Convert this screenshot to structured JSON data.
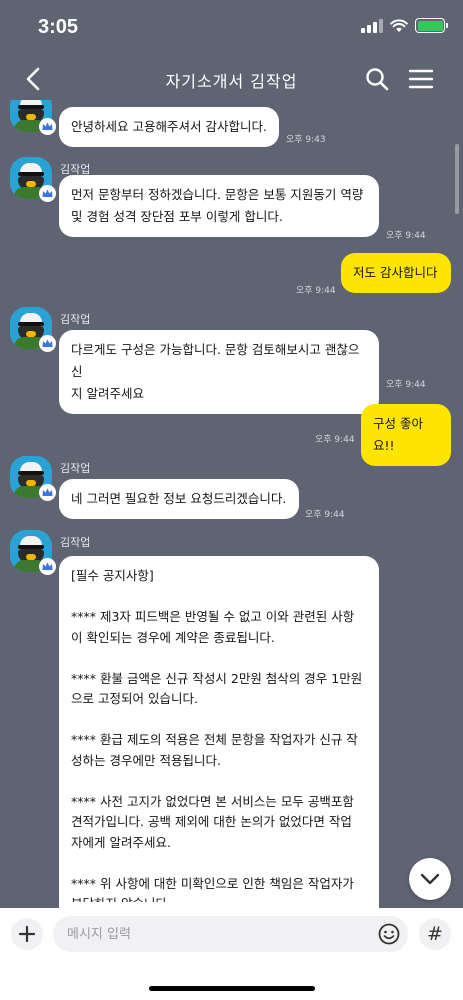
{
  "status": {
    "time": "3:05"
  },
  "header": {
    "title": "자기소개서 김작업"
  },
  "chat": {
    "messages": [
      {
        "sender": "",
        "text": "안녕하세요 고용해주셔서 감사합니다.",
        "time": "오후 9:43"
      },
      {
        "sender": "김작업",
        "text": "먼저 문항부터 정하겠습니다. 문항은 보통 지원동기 역량\n및 경험 성격 장단점 포부 이렇게 합니다.",
        "time": "오후 9:44"
      },
      {
        "text": "저도 감사합니다",
        "time": "오후 9:44"
      },
      {
        "sender": "김작업",
        "text": "다르게도 구성은 가능합니다. 문항 검토해보시고 괜찮으신\n지 알려주세요",
        "time": "오후 9:44"
      },
      {
        "text": "구성 좋아요!!",
        "time": "오후 9:44"
      },
      {
        "sender": "김작업",
        "text": "네 그러면 필요한 정보 요청드리겠습니다.",
        "time": "오후 9:44"
      },
      {
        "sender": "김작업",
        "text": "[필수 공지사항]\n\n**** 제3자 피드백은 반영될 수 없고 이와 관련된 사항\n이 확인되는 경우에 계약은 종료됩니다.\n\n**** 환불 금액은 신규 작성시 2만원 첨삭의 경우 1만원\n으로 고정되어 있습니다.\n\n**** 환급 제도의 적용은 전체 문항을 작업자가 신규 작\n성하는 경우에만 적용됩니다.\n\n**** 사전 고지가 없었다면 본 서비스는 모두 공백포함\n견적가입니다. 공백 제외에 대한 논의가 없었다면 작업\n자에게 알려주세요.\n\n**** 위 사항에 대한 미확인으로 인한 책임은 작업자가\n부담하지 않습니다."
      }
    ]
  },
  "input": {
    "placeholder": "메시지 입력"
  },
  "icons": {
    "back": "back-arrow-icon",
    "search": "search-icon",
    "menu": "hamburger-menu-icon",
    "plus": "plus-icon",
    "emoji": "emoji-icon",
    "hash": "#",
    "scroll_down": "chevron-down-icon",
    "crown": "crown-icon"
  },
  "colors": {
    "background": "#5f6472",
    "my_bubble": "#fee500",
    "other_bubble": "#ffffff",
    "crown": "#3a74e8",
    "battery": "#34c759"
  }
}
